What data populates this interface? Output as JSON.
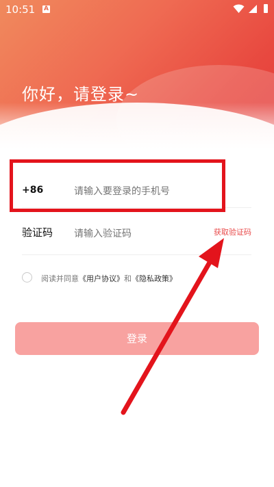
{
  "status_bar": {
    "time": "10:51",
    "app_badge": "A",
    "icons": [
      "wifi-icon",
      "signal-icon",
      "battery-icon"
    ]
  },
  "header": {
    "greeting": "你好，请登录~"
  },
  "phone_row": {
    "country_code": "+86",
    "placeholder": "请输入要登录的手机号"
  },
  "code_row": {
    "label": "验证码",
    "placeholder": "请输入验证码",
    "get_code": "获取验证码"
  },
  "agreement": {
    "prefix": "阅读并同意",
    "user_agreement": "《用户协议》",
    "and": "和",
    "privacy_policy": "《隐私政策》"
  },
  "login_button": {
    "label": "登录"
  },
  "colors": {
    "accent": "#e84a4a",
    "button": "#f8a2a0",
    "annotation": "#e3141c"
  }
}
